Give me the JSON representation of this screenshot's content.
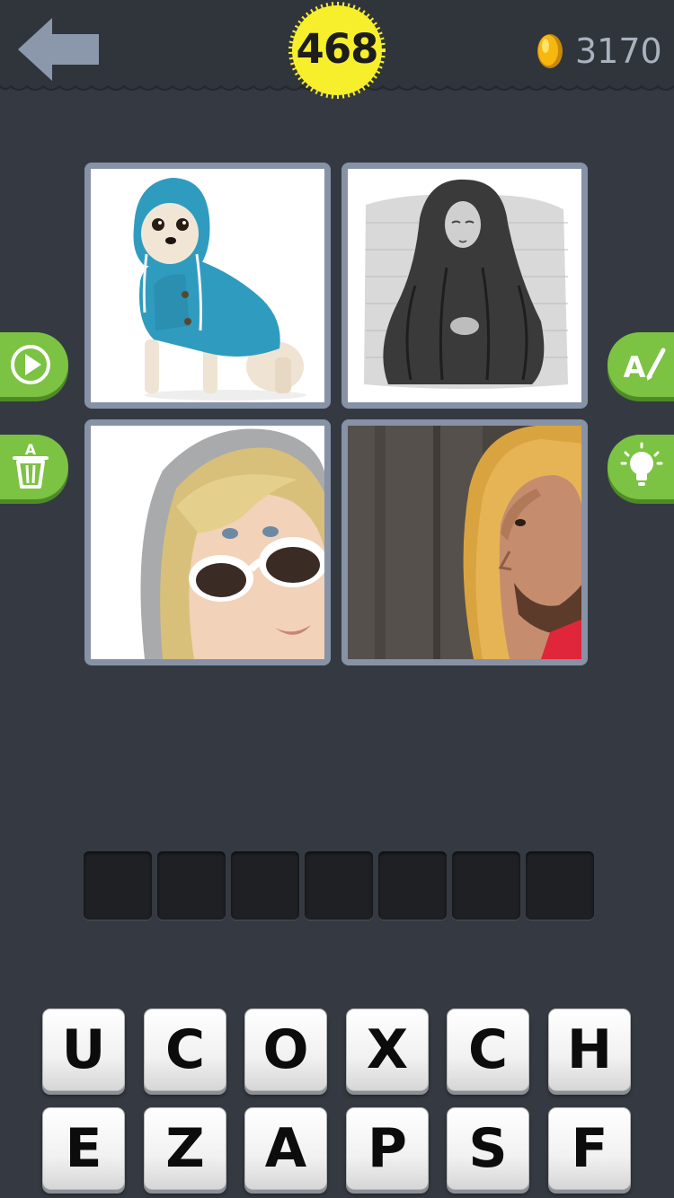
{
  "header": {
    "level": "468",
    "coins": "3170",
    "back_icon": "back-arrow-icon",
    "coin_icon": "coin-icon",
    "badge_color": "#f7ef2b"
  },
  "puzzle": {
    "pictures": [
      {
        "subject": "chihuahua-in-blue-hoodie"
      },
      {
        "subject": "engraving-of-hooded-woman"
      },
      {
        "subject": "blonde-woman-in-grey-hoodie-with-sunglasses"
      },
      {
        "subject": "man-in-yellow-hood"
      }
    ],
    "answer_length": 7,
    "answer_slots": [
      "",
      "",
      "",
      "",
      "",
      "",
      ""
    ]
  },
  "hints": {
    "left": [
      {
        "name": "video-play-icon"
      },
      {
        "name": "remove-letters-trash-icon"
      }
    ],
    "right": [
      {
        "name": "reveal-letter-icon"
      },
      {
        "name": "lightbulb-solve-icon"
      }
    ],
    "accent": "#7cc243"
  },
  "keyboard": {
    "row1": [
      "U",
      "C",
      "O",
      "X",
      "C",
      "H"
    ],
    "row2": [
      "E",
      "Z",
      "A",
      "P",
      "S",
      "F"
    ]
  }
}
